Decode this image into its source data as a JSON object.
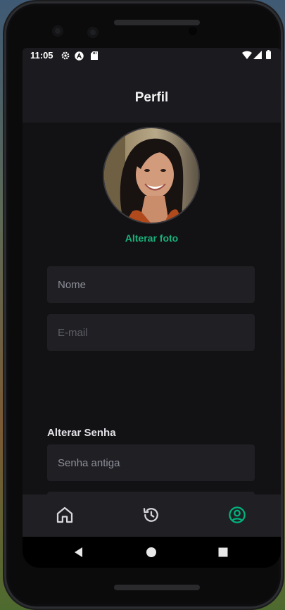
{
  "status": {
    "time": "11:05"
  },
  "header": {
    "title": "Perfil"
  },
  "profile": {
    "change_photo_label": "Alterar foto"
  },
  "form": {
    "name_placeholder": "Nome",
    "email_placeholder": "E-mail",
    "password_section_title": "Alterar Senha",
    "old_password_placeholder": "Senha antiga"
  },
  "tabs": [
    {
      "icon": "home-icon",
      "active": false
    },
    {
      "icon": "history-icon",
      "active": false
    },
    {
      "icon": "user-circle-icon",
      "active": true
    }
  ],
  "colors": {
    "accent": "#00B37E",
    "surface": "#202024",
    "background": "#121214"
  }
}
